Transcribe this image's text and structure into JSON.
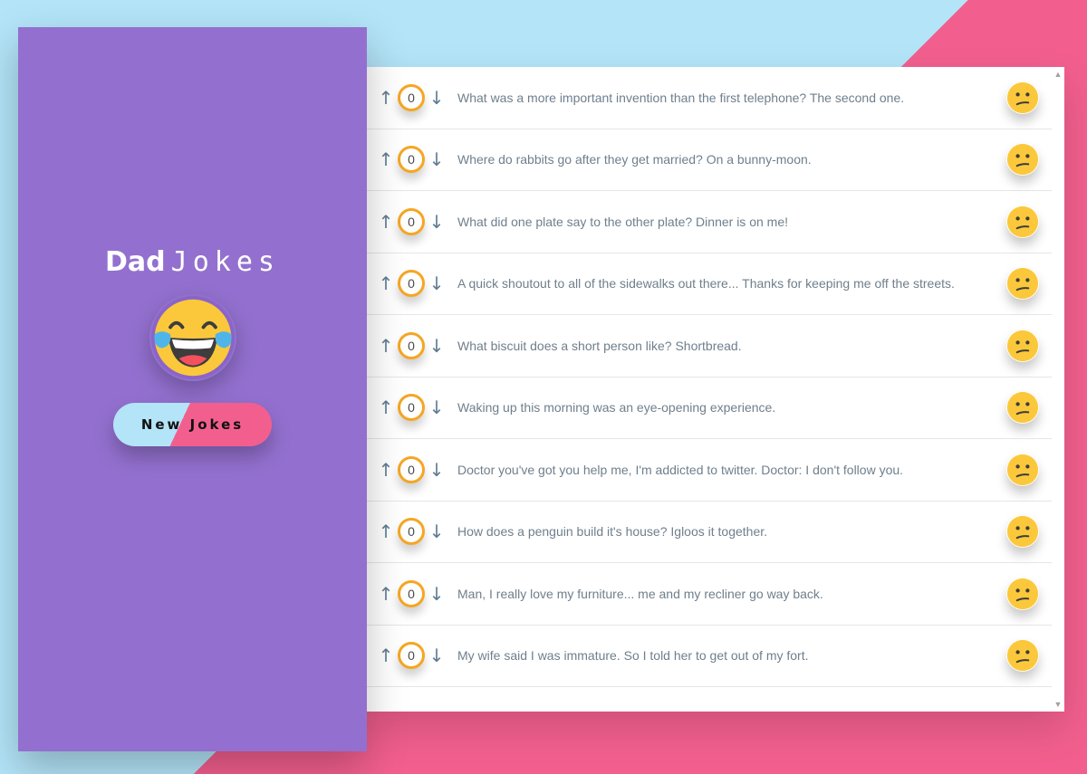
{
  "sidebar": {
    "title_bold": "Dad",
    "title_thin": "Jokes",
    "logo_icon": "laughing-tears-emoji-icon",
    "button_label": "New Jokes"
  },
  "jokes": [
    {
      "text": "What was a more important invention than the first telephone? The second one.",
      "votes": "0",
      "emoji": "confused-face-icon"
    },
    {
      "text": "Where do rabbits go after they get married? On a bunny-moon.",
      "votes": "0",
      "emoji": "confused-face-icon"
    },
    {
      "text": "What did one plate say to the other plate? Dinner is on me!",
      "votes": "0",
      "emoji": "confused-face-icon"
    },
    {
      "text": "A quick shoutout to all of the sidewalks out there... Thanks for keeping me off the streets.",
      "votes": "0",
      "emoji": "confused-face-icon"
    },
    {
      "text": "What biscuit does a short person like? Shortbread.",
      "votes": "0",
      "emoji": "confused-face-icon"
    },
    {
      "text": "Waking up this morning was an eye-opening experience.",
      "votes": "0",
      "emoji": "confused-face-icon"
    },
    {
      "text": "Doctor you've got you help me, I'm addicted to twitter. Doctor: I don't follow you.",
      "votes": "0",
      "emoji": "confused-face-icon"
    },
    {
      "text": "How does a penguin build it's house? Igloos it together.",
      "votes": "0",
      "emoji": "confused-face-icon"
    },
    {
      "text": "Man, I really love my furniture... me and my recliner go way back.",
      "votes": "0",
      "emoji": "confused-face-icon"
    },
    {
      "text": "My wife said I was immature. So I told her to get out of my fort.",
      "votes": "0",
      "emoji": "confused-face-icon"
    }
  ],
  "icons": {
    "upvote": "↑",
    "downvote": "↓",
    "scroll_up": "▲",
    "scroll_down": "▼"
  },
  "colors": {
    "sidebar_bg": "#9370cf",
    "bg_blue": "#b3e4f8",
    "bg_pink": "#f25f8e",
    "score_border": "#f5a623",
    "emoji_yellow": "#fcc83b"
  }
}
